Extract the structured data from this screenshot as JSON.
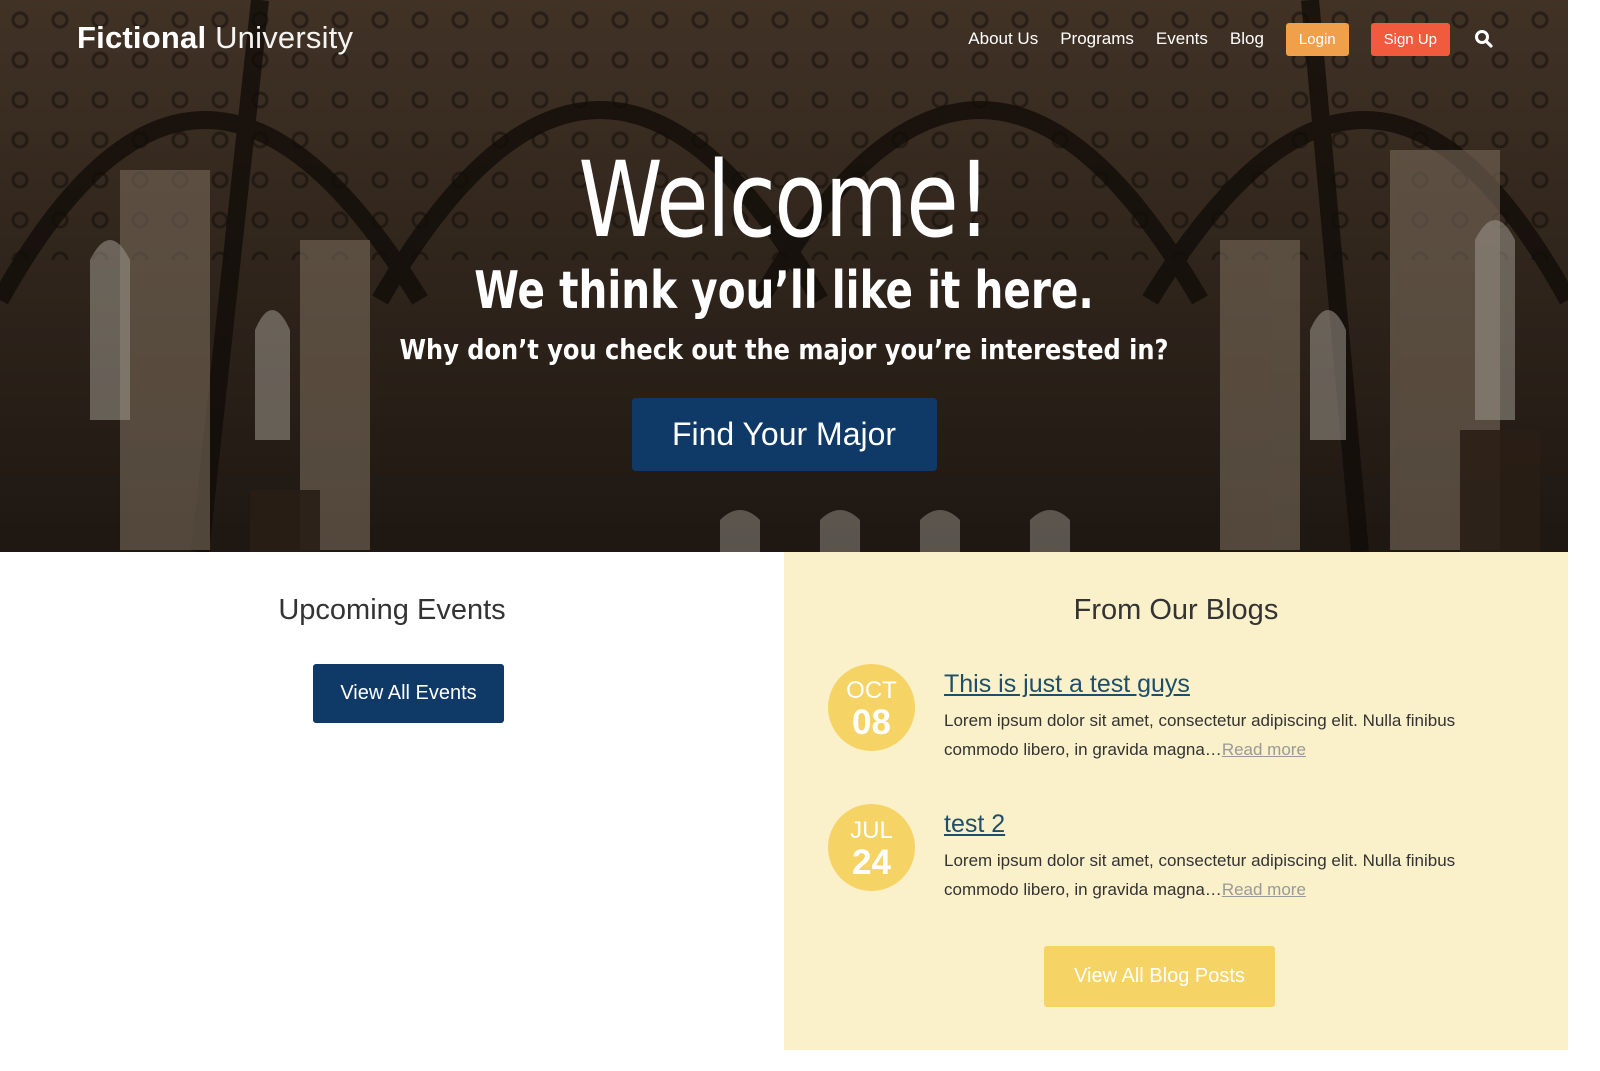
{
  "header": {
    "logo_strong": "Fictional",
    "logo_light": "University",
    "nav": [
      "About Us",
      "Programs",
      "Events",
      "Blog"
    ],
    "login_label": "Login",
    "signup_label": "Sign Up",
    "search_icon": "search-icon"
  },
  "hero": {
    "title": "Welcome!",
    "subtitle": "We think you’ll like it here.",
    "prompt_before": "Why don’t you check out the ",
    "prompt_strong": "major",
    "prompt_after": " you’re interested in?",
    "cta_label": "Find Your Major"
  },
  "events": {
    "title": "Upcoming Events",
    "button_label": "View All Events"
  },
  "blogs": {
    "title": "From Our Blogs",
    "posts": [
      {
        "month": "OCT",
        "day": "08",
        "title": "This is just a test guys",
        "excerpt": "Lorem ipsum dolor sit amet, consectetur adipiscing elit. Nulla finibus commodo libero, in gravida magna…",
        "read_more": "Read more"
      },
      {
        "month": "JUL",
        "day": "24",
        "title": "test 2",
        "excerpt": "Lorem ipsum dolor sit amet, consectetur adipiscing elit. Nulla finibus commodo libero, in gravida magna…",
        "read_more": "Read more"
      }
    ],
    "button_label": "View All Blog Posts"
  },
  "colors": {
    "primary_blue": "#0f3966",
    "login_orange": "#f0a04b",
    "signup_red": "#f25a3e",
    "blog_bg": "#faf0ca",
    "date_yellow": "#f6d365"
  }
}
